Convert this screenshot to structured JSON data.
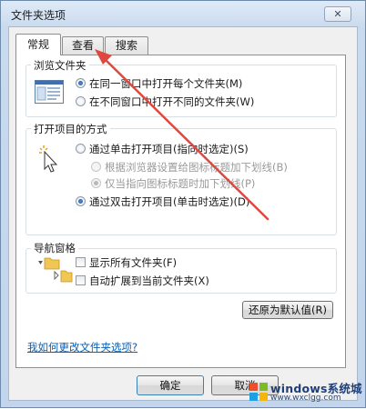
{
  "window": {
    "title": "文件夹选项",
    "close_icon": "close-icon"
  },
  "tabs": [
    {
      "label": "常规",
      "active": true
    },
    {
      "label": "查看",
      "active": false
    },
    {
      "label": "搜索",
      "active": false
    }
  ],
  "browse_folders": {
    "title": "浏览文件夹",
    "options": [
      {
        "label": "在同一窗口中打开每个文件夹(M)",
        "checked": true
      },
      {
        "label": "在不同窗口中打开不同的文件夹(W)",
        "checked": false
      }
    ]
  },
  "open_items": {
    "title": "打开项目的方式",
    "options": [
      {
        "label": "通过单击打开项目(指向时选定)(S)",
        "checked": false
      },
      {
        "label": "根据浏览器设置给图标标题加下划线(B)",
        "checked": false,
        "disabled": true
      },
      {
        "label": "仅当指向图标标题时加下划线(P)",
        "checked": true,
        "disabled": true
      },
      {
        "label": "通过双击打开项目(单击时选定)(D)",
        "checked": true
      }
    ]
  },
  "nav_pane": {
    "title": "导航窗格",
    "options": [
      {
        "label": "显示所有文件夹(F)",
        "checked": false
      },
      {
        "label": "自动扩展到当前文件夹(X)",
        "checked": false
      }
    ]
  },
  "restore_defaults_label": "还原为默认值(R)",
  "help_link": "我如何更改文件夹选项?",
  "footer": {
    "ok_label": "确定",
    "cancel_label": "取消"
  },
  "watermark": {
    "brand": "windows系统城",
    "url": "www.wxclgg.com"
  },
  "colors": {
    "arrow": "#e0483f",
    "link": "#0a5fb4",
    "accent": "#1d4f94"
  }
}
